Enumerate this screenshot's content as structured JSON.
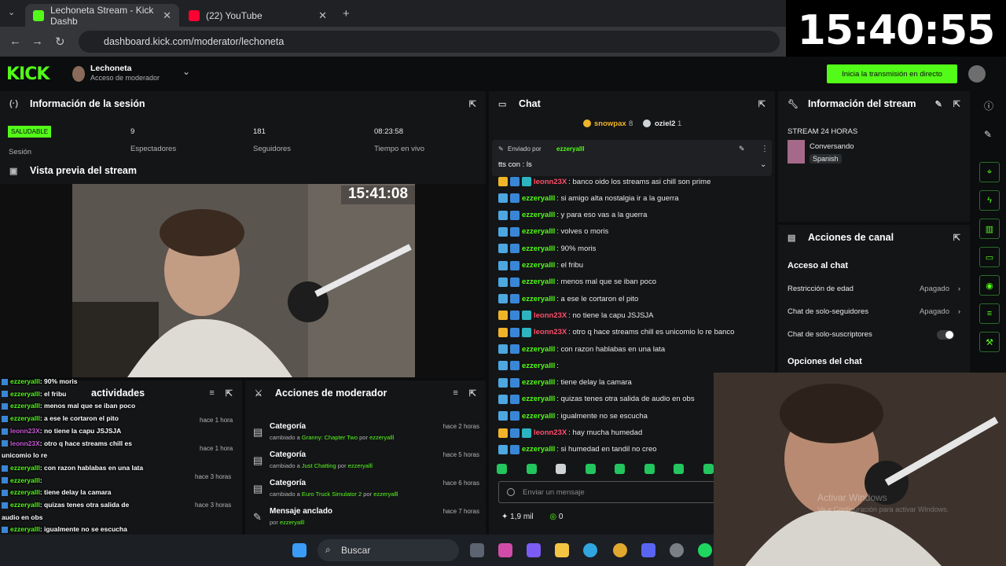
{
  "browser": {
    "tabs": [
      {
        "label": "Lechoneta Stream - Kick Dashb",
        "active": true
      },
      {
        "label": "(22) YouTube",
        "active": false
      }
    ],
    "url": "dashboard.kick.com/moderator/lechoneta"
  },
  "overlay_clock": "15:40:55",
  "header": {
    "logo": "KICK",
    "channel_name": "Lechoneta",
    "channel_role": "Acceso de moderador",
    "go_live_label": "Inicia la transmisión en directo"
  },
  "session": {
    "title": "Información de la sesión",
    "status": "SALUDABLE",
    "status_label": "Sesión",
    "stats": [
      {
        "value": "9",
        "label": "Espectadores"
      },
      {
        "value": "181",
        "label": "Seguidores"
      },
      {
        "value": "08:23:58",
        "label": "Tiempo en vivo"
      }
    ]
  },
  "preview": {
    "title": "Vista previa del stream",
    "clock": "15:41:08"
  },
  "activities": {
    "title": "actividades",
    "times": [
      "hace 1 hora",
      "hace 1 hora",
      "hace 3 horas",
      "hace 3 horas"
    ]
  },
  "overlay_chat": [
    {
      "user": "ezzeryalll",
      "msg": ": 90% moris"
    },
    {
      "user": "ezzeryalll",
      "msg": ": el fribu"
    },
    {
      "user": "ezzeryalll",
      "msg": ": menos mal que se iban poco"
    },
    {
      "user": "ezzeryalll",
      "msg": ": a ese le cortaron el pito"
    },
    {
      "user": "leonn23X",
      "msg": ": no tiene la capu JSJSJA"
    },
    {
      "user": "leonn23X",
      "msg": ": otro q hace streams chill es"
    },
    {
      "user": "",
      "msg": "unicomio lo re"
    },
    {
      "user": "ezzeryalll",
      "msg": ": con razon hablabas en una lata"
    },
    {
      "user": "ezzeryalll",
      "msg": ":"
    },
    {
      "user": "ezzeryalll",
      "msg": ": tiene delay la camara"
    },
    {
      "user": "ezzeryalll",
      "msg": ": quizas tenes otra salida de"
    },
    {
      "user": "",
      "msg": "audio en obs"
    },
    {
      "user": "ezzeryalll",
      "msg": ": igualmente no se escucha"
    },
    {
      "user": "leonn23X",
      "msg": ": hay mucha humedad"
    },
    {
      "user": "ezzeryalll",
      "msg": ": si humedad en tandil no creo"
    }
  ],
  "mod_actions": {
    "title": "Acciones de moderador",
    "rows": [
      {
        "title": "Categoría",
        "desc_prefix": "cambiado a",
        "target": "Granny: Chapter Two",
        "by_prefix": "por",
        "by": "ezzeryalll",
        "time": "hace 2 horas"
      },
      {
        "title": "Categoría",
        "desc_prefix": "cambiado a",
        "target": "Just Chatting",
        "by_prefix": "por",
        "by": "ezzeryalll",
        "time": "hace 5 horas"
      },
      {
        "title": "Categoría",
        "desc_prefix": "cambiado a",
        "target": "Euro Truck Simulator 2",
        "by_prefix": "por",
        "by": "ezzeryalll",
        "time": "hace 6 horas"
      },
      {
        "title": "Mensaje anclado",
        "desc_prefix": "",
        "target": "",
        "by_prefix": "por",
        "by": "ezzeryalll",
        "time": "hace 7 horas"
      }
    ]
  },
  "chat": {
    "title": "Chat",
    "top_users": [
      {
        "name": "snowpax",
        "count": "8"
      },
      {
        "name": "oziel2",
        "count": "1"
      }
    ],
    "pinned": {
      "sent_by_label": "Enviado por",
      "sent_by": "ezzeryalll",
      "text": "tts con : ls"
    },
    "messages": [
      {
        "user": "leonn23X",
        "msg": ": banco oido los streams asi chill son prime",
        "red": true
      },
      {
        "user": "ezzeryalll",
        "msg": ": si amigo alta nostalgia ir a la guerra",
        "red": false
      },
      {
        "user": "ezzeryalll",
        "msg": ": y para eso vas a la guerra",
        "red": false
      },
      {
        "user": "ezzeryalll",
        "msg": ": volves o moris",
        "red": false
      },
      {
        "user": "ezzeryalll",
        "msg": ": 90% moris",
        "red": false
      },
      {
        "user": "ezzeryalll",
        "msg": ": el fribu",
        "red": false
      },
      {
        "user": "ezzeryalll",
        "msg": ": menos mal que se iban poco",
        "red": false
      },
      {
        "user": "ezzeryalll",
        "msg": ": a ese le cortaron el pito",
        "red": false
      },
      {
        "user": "leonn23X",
        "msg": ": no tiene la capu JSJSJA",
        "red": true
      },
      {
        "user": "leonn23X",
        "msg": ": otro q hace streams chill es unicomio lo re banco",
        "red": true
      },
      {
        "user": "ezzeryalll",
        "msg": ": con razon hablabas en una lata",
        "red": false
      },
      {
        "user": "ezzeryalll",
        "msg": ":",
        "red": false
      },
      {
        "user": "ezzeryalll",
        "msg": ": tiene delay la camara",
        "red": false
      },
      {
        "user": "ezzeryalll",
        "msg": ": quizas tenes otra salida de audio en obs",
        "red": false
      },
      {
        "user": "ezzeryalll",
        "msg": ": igualmente no se escucha",
        "red": false
      },
      {
        "user": "leonn23X",
        "msg": ": hay mucha humedad",
        "red": true
      },
      {
        "user": "ezzeryalll",
        "msg": ": si humedad en tandil no creo",
        "red": false
      }
    ],
    "input_placeholder": "Enviar un mensaje",
    "footer": {
      "viewers": "1,9 mil",
      "points": "0"
    }
  },
  "stream_info": {
    "title": "Información del stream",
    "stream_title": "STREAM 24 HORAS",
    "category": "Conversando",
    "language": "Spanish"
  },
  "channel_actions": {
    "title": "Acciones de canal",
    "chat_access_heading": "Acceso al chat",
    "settings": [
      {
        "label": "Restricción de edad",
        "value": "Apagado"
      },
      {
        "label": "Chat de solo-seguidores",
        "value": "Apagado"
      },
      {
        "label": "Chat de solo-suscriptores",
        "value": ""
      }
    ],
    "chat_options_heading": "Opciones del chat"
  },
  "windows": {
    "activate_title": "Activar Windows",
    "activate_sub": "Ve a Configuración para activar Windows.",
    "search_label": "Buscar"
  },
  "colors": {
    "kick_green": "#53fc18",
    "panel": "#141517",
    "background": "#0b0d0e"
  }
}
